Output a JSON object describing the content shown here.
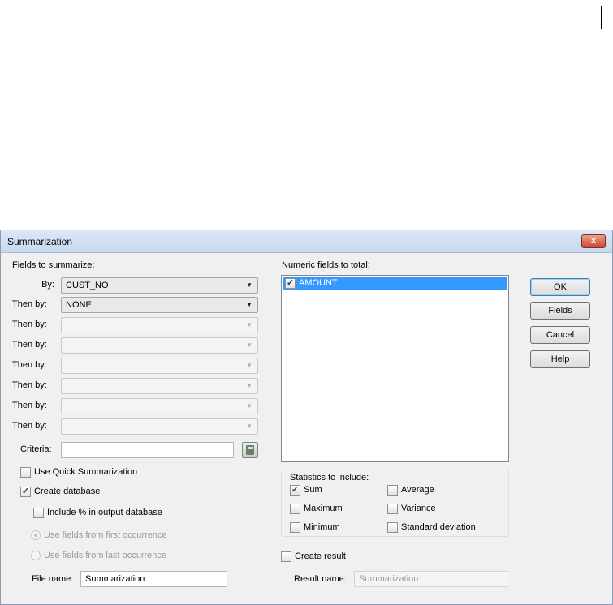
{
  "dialog": {
    "title": "Summarization",
    "close_label": "x"
  },
  "fields_to_summarize": {
    "heading": "Fields to summarize:",
    "rows": [
      {
        "label": "By:",
        "value": "CUST_NO"
      },
      {
        "label": "Then by:",
        "value": "NONE"
      },
      {
        "label": "Then by:",
        "value": ""
      },
      {
        "label": "Then by:",
        "value": ""
      },
      {
        "label": "Then by:",
        "value": ""
      },
      {
        "label": "Then by:",
        "value": ""
      },
      {
        "label": "Then by:",
        "value": ""
      },
      {
        "label": "Then by:",
        "value": ""
      }
    ],
    "criteria_label": "Criteria:",
    "criteria_value": ""
  },
  "options": {
    "quick_summarization": {
      "label": "Use Quick Summarization",
      "checked": false
    },
    "create_database": {
      "label": "Create database",
      "checked": true
    },
    "include_percent": {
      "label": "Include % in output database",
      "checked": false
    },
    "first_occurrence": {
      "label": "Use fields from first occurrence",
      "selected": true
    },
    "last_occurrence": {
      "label": "Use fields from last occurrence",
      "selected": false
    },
    "file_name_label": "File name:",
    "file_name_value": "Summarization"
  },
  "numeric_fields": {
    "heading": "Numeric fields to total:",
    "items": [
      {
        "label": "AMOUNT",
        "checked": true
      }
    ]
  },
  "buttons": {
    "ok": "OK",
    "fields": "Fields",
    "cancel": "Cancel",
    "help": "Help"
  },
  "statistics": {
    "heading": "Statistics to include:",
    "sum": "Sum",
    "maximum": "Maximum",
    "minimum": "Minimum",
    "average": "Average",
    "variance": "Variance",
    "std_dev": "Standard deviation"
  },
  "result": {
    "create_result_label": "Create result",
    "result_name_label": "Result name:",
    "result_name_value": "Summarization"
  }
}
